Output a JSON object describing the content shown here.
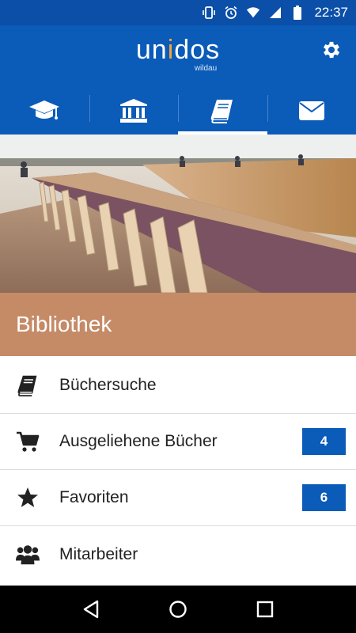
{
  "status_bar": {
    "time": "22:37",
    "icons": [
      "vibrate-icon",
      "alarm-icon",
      "wifi-icon",
      "signal-icon",
      "battery-icon"
    ]
  },
  "header": {
    "logo_part1": "un",
    "logo_accent": "i",
    "logo_part2": "dos",
    "logo_sub": "wildau",
    "settings_icon": "gear-icon"
  },
  "tabs": [
    {
      "icon": "graduation-cap-icon",
      "active": false
    },
    {
      "icon": "institution-icon",
      "active": false
    },
    {
      "icon": "book-icon",
      "active": true
    },
    {
      "icon": "envelope-icon",
      "active": false
    }
  ],
  "section": {
    "title": "Bibliothek",
    "color": "#c58a66"
  },
  "menu": [
    {
      "label": "Büchersuche",
      "icon": "book-icon",
      "badge": null
    },
    {
      "label": "Ausgeliehene Bücher",
      "icon": "cart-icon",
      "badge": "4"
    },
    {
      "label": "Favoriten",
      "icon": "star-icon",
      "badge": "6"
    },
    {
      "label": "Mitarbeiter",
      "icon": "users-icon",
      "badge": null
    }
  ],
  "nav": [
    "back-icon",
    "home-icon",
    "recents-icon"
  ],
  "colors": {
    "brand_blue": "#0b5bb8",
    "status_blue": "#0b4fa8",
    "logo_accent": "#f2a43a"
  }
}
